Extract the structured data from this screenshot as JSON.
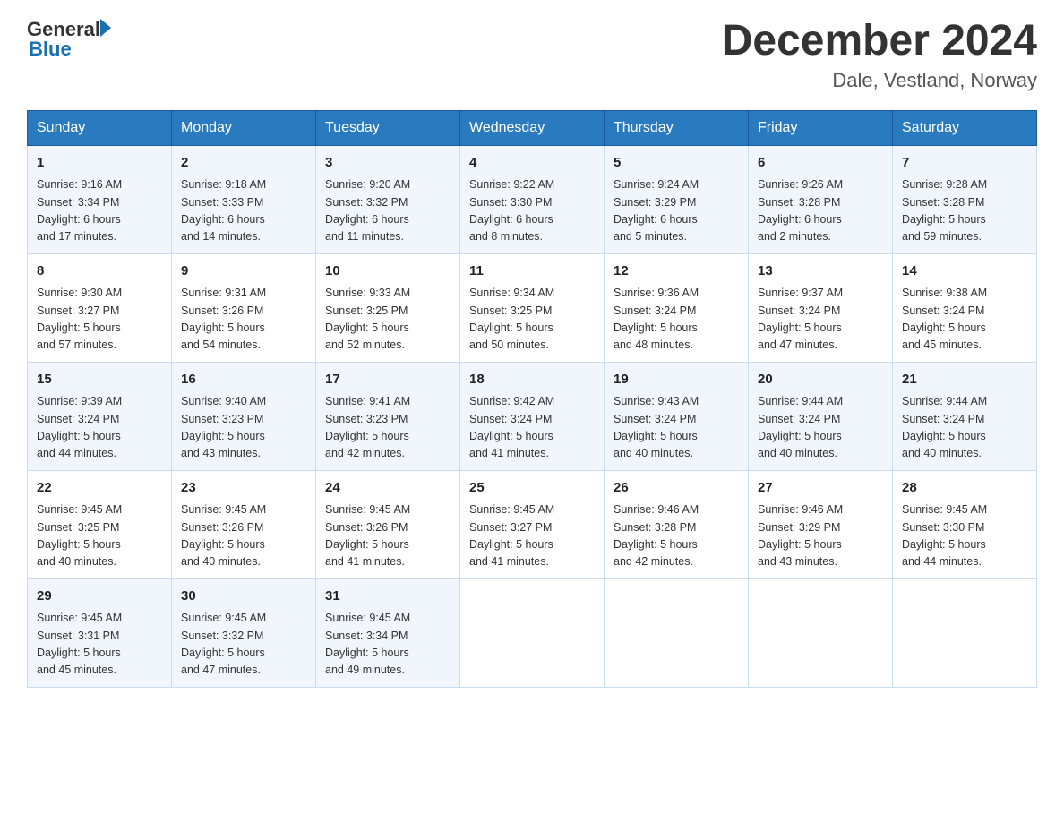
{
  "header": {
    "logo_general": "General",
    "logo_blue": "Blue",
    "month_title": "December 2024",
    "location": "Dale, Vestland, Norway"
  },
  "days_of_week": [
    "Sunday",
    "Monday",
    "Tuesday",
    "Wednesday",
    "Thursday",
    "Friday",
    "Saturday"
  ],
  "weeks": [
    [
      {
        "day": "1",
        "info": "Sunrise: 9:16 AM\nSunset: 3:34 PM\nDaylight: 6 hours\nand 17 minutes."
      },
      {
        "day": "2",
        "info": "Sunrise: 9:18 AM\nSunset: 3:33 PM\nDaylight: 6 hours\nand 14 minutes."
      },
      {
        "day": "3",
        "info": "Sunrise: 9:20 AM\nSunset: 3:32 PM\nDaylight: 6 hours\nand 11 minutes."
      },
      {
        "day": "4",
        "info": "Sunrise: 9:22 AM\nSunset: 3:30 PM\nDaylight: 6 hours\nand 8 minutes."
      },
      {
        "day": "5",
        "info": "Sunrise: 9:24 AM\nSunset: 3:29 PM\nDaylight: 6 hours\nand 5 minutes."
      },
      {
        "day": "6",
        "info": "Sunrise: 9:26 AM\nSunset: 3:28 PM\nDaylight: 6 hours\nand 2 minutes."
      },
      {
        "day": "7",
        "info": "Sunrise: 9:28 AM\nSunset: 3:28 PM\nDaylight: 5 hours\nand 59 minutes."
      }
    ],
    [
      {
        "day": "8",
        "info": "Sunrise: 9:30 AM\nSunset: 3:27 PM\nDaylight: 5 hours\nand 57 minutes."
      },
      {
        "day": "9",
        "info": "Sunrise: 9:31 AM\nSunset: 3:26 PM\nDaylight: 5 hours\nand 54 minutes."
      },
      {
        "day": "10",
        "info": "Sunrise: 9:33 AM\nSunset: 3:25 PM\nDaylight: 5 hours\nand 52 minutes."
      },
      {
        "day": "11",
        "info": "Sunrise: 9:34 AM\nSunset: 3:25 PM\nDaylight: 5 hours\nand 50 minutes."
      },
      {
        "day": "12",
        "info": "Sunrise: 9:36 AM\nSunset: 3:24 PM\nDaylight: 5 hours\nand 48 minutes."
      },
      {
        "day": "13",
        "info": "Sunrise: 9:37 AM\nSunset: 3:24 PM\nDaylight: 5 hours\nand 47 minutes."
      },
      {
        "day": "14",
        "info": "Sunrise: 9:38 AM\nSunset: 3:24 PM\nDaylight: 5 hours\nand 45 minutes."
      }
    ],
    [
      {
        "day": "15",
        "info": "Sunrise: 9:39 AM\nSunset: 3:24 PM\nDaylight: 5 hours\nand 44 minutes."
      },
      {
        "day": "16",
        "info": "Sunrise: 9:40 AM\nSunset: 3:23 PM\nDaylight: 5 hours\nand 43 minutes."
      },
      {
        "day": "17",
        "info": "Sunrise: 9:41 AM\nSunset: 3:23 PM\nDaylight: 5 hours\nand 42 minutes."
      },
      {
        "day": "18",
        "info": "Sunrise: 9:42 AM\nSunset: 3:24 PM\nDaylight: 5 hours\nand 41 minutes."
      },
      {
        "day": "19",
        "info": "Sunrise: 9:43 AM\nSunset: 3:24 PM\nDaylight: 5 hours\nand 40 minutes."
      },
      {
        "day": "20",
        "info": "Sunrise: 9:44 AM\nSunset: 3:24 PM\nDaylight: 5 hours\nand 40 minutes."
      },
      {
        "day": "21",
        "info": "Sunrise: 9:44 AM\nSunset: 3:24 PM\nDaylight: 5 hours\nand 40 minutes."
      }
    ],
    [
      {
        "day": "22",
        "info": "Sunrise: 9:45 AM\nSunset: 3:25 PM\nDaylight: 5 hours\nand 40 minutes."
      },
      {
        "day": "23",
        "info": "Sunrise: 9:45 AM\nSunset: 3:26 PM\nDaylight: 5 hours\nand 40 minutes."
      },
      {
        "day": "24",
        "info": "Sunrise: 9:45 AM\nSunset: 3:26 PM\nDaylight: 5 hours\nand 41 minutes."
      },
      {
        "day": "25",
        "info": "Sunrise: 9:45 AM\nSunset: 3:27 PM\nDaylight: 5 hours\nand 41 minutes."
      },
      {
        "day": "26",
        "info": "Sunrise: 9:46 AM\nSunset: 3:28 PM\nDaylight: 5 hours\nand 42 minutes."
      },
      {
        "day": "27",
        "info": "Sunrise: 9:46 AM\nSunset: 3:29 PM\nDaylight: 5 hours\nand 43 minutes."
      },
      {
        "day": "28",
        "info": "Sunrise: 9:45 AM\nSunset: 3:30 PM\nDaylight: 5 hours\nand 44 minutes."
      }
    ],
    [
      {
        "day": "29",
        "info": "Sunrise: 9:45 AM\nSunset: 3:31 PM\nDaylight: 5 hours\nand 45 minutes."
      },
      {
        "day": "30",
        "info": "Sunrise: 9:45 AM\nSunset: 3:32 PM\nDaylight: 5 hours\nand 47 minutes."
      },
      {
        "day": "31",
        "info": "Sunrise: 9:45 AM\nSunset: 3:34 PM\nDaylight: 5 hours\nand 49 minutes."
      },
      {
        "day": "",
        "info": ""
      },
      {
        "day": "",
        "info": ""
      },
      {
        "day": "",
        "info": ""
      },
      {
        "day": "",
        "info": ""
      }
    ]
  ]
}
